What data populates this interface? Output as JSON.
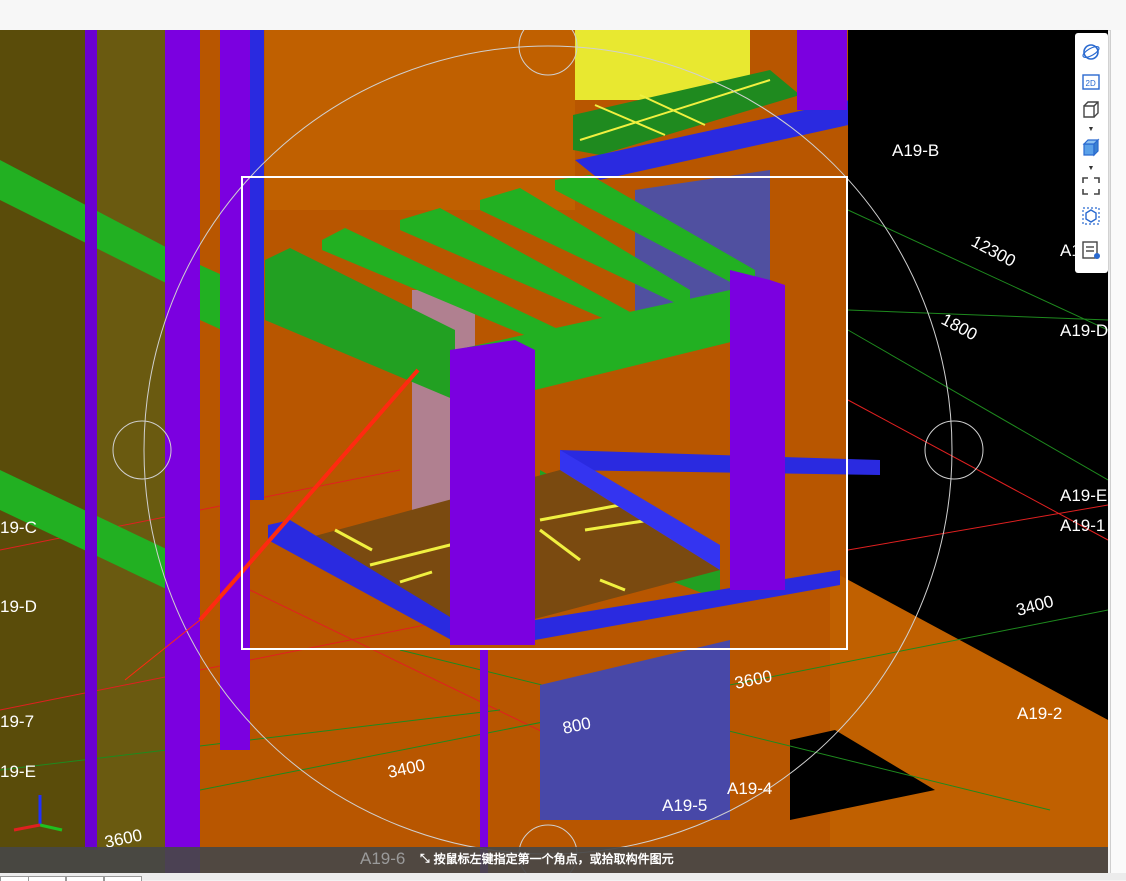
{
  "title_bar": {
    "text": ""
  },
  "axis_labels": [
    {
      "id": "a19-b",
      "text": "A19-B"
    },
    {
      "id": "a19-a1",
      "text": "A1"
    },
    {
      "id": "a19-d-right",
      "text": "A19-D"
    },
    {
      "id": "a19-e-right",
      "text": "A19-E"
    },
    {
      "id": "a19-1",
      "text": "A19-1"
    },
    {
      "id": "a19-2",
      "text": "A19-2"
    },
    {
      "id": "a19-4",
      "text": "A19-4"
    },
    {
      "id": "a19-5",
      "text": "A19-5"
    },
    {
      "id": "a19-c-left",
      "text": "19-C"
    },
    {
      "id": "a19-d-left",
      "text": "19-D"
    },
    {
      "id": "a19-7-left",
      "text": "19-7"
    },
    {
      "id": "a19-e-left",
      "text": "19-E"
    }
  ],
  "dimensions": [
    {
      "id": "dim-12300",
      "text": "12300"
    },
    {
      "id": "dim-1800",
      "text": "1800"
    },
    {
      "id": "dim-3400-right",
      "text": "3400"
    },
    {
      "id": "dim-3600-mid",
      "text": "3600"
    },
    {
      "id": "dim-800",
      "text": "800"
    },
    {
      "id": "dim-3400-left",
      "text": "3400"
    },
    {
      "id": "dim-3600-bottom",
      "text": "3600"
    }
  ],
  "status": {
    "hint": "按鼠标左键指定第一个角点，或拾取构件图元",
    "grid_label": "A19-6"
  },
  "toolbar": {
    "items": [
      {
        "name": "orbit-icon"
      },
      {
        "name": "2d-view-icon",
        "label": "2D"
      },
      {
        "name": "cube-wireframe-icon"
      },
      {
        "name": "cube-solid-icon"
      },
      {
        "name": "fullscreen-icon"
      },
      {
        "name": "component-view-icon"
      },
      {
        "name": "properties-list-icon"
      }
    ]
  },
  "colors": {
    "wall_orange": "#bf5c00",
    "beam_green": "#22b022",
    "column_purple": "#7b00e0",
    "beam_blue": "#2a2ae0",
    "rebar_yellow": "#f0f040",
    "grid_red": "#e02020",
    "grid_green": "#1e8a1e",
    "selection_white": "#ffffff"
  }
}
